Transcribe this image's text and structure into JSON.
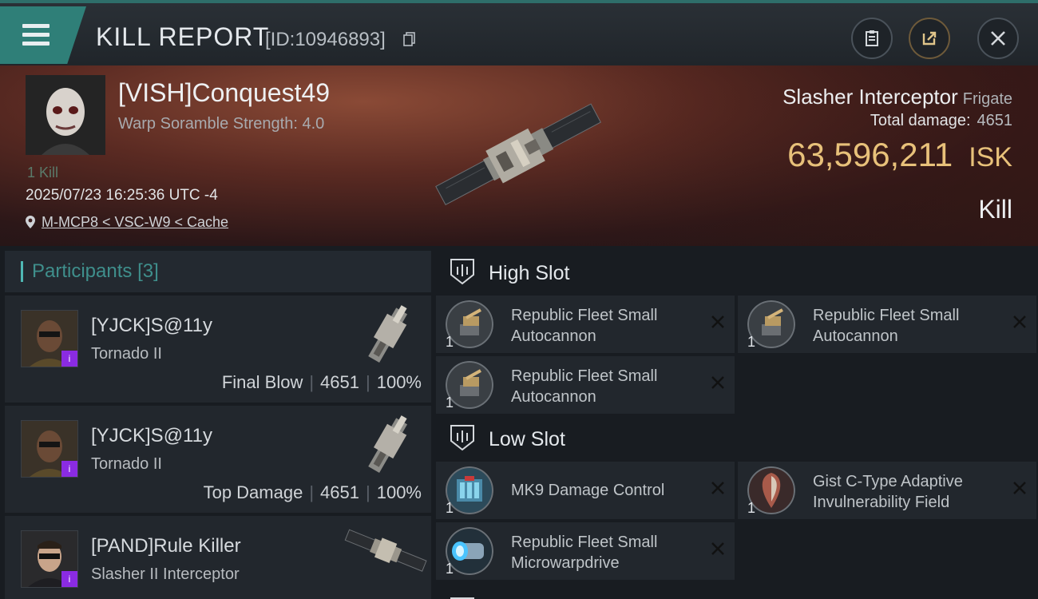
{
  "header": {
    "title": "KILL REPORT",
    "report_id": "[ID:10946893]"
  },
  "victim": {
    "name": "[VISH]Conquest49",
    "warp_strength": "Warp Soramble Strength: 4.0",
    "kill_count": "1 Kill",
    "timestamp": "2025/07/23 16:25:36 UTC -4",
    "location": "M-MCP8 < VSC-W9 < Cache",
    "ship_name": "Slasher Interceptor",
    "ship_class": "Frigate",
    "total_damage_label": "Total damage:",
    "total_damage": "4651",
    "isk_value": "63,596,211",
    "isk_unit": "ISK",
    "result": "Kill"
  },
  "participants": {
    "title": "Participants",
    "count": "[3]",
    "rows": [
      {
        "name": "[YJCK]S@11y",
        "ship": "Tornado II",
        "role": "Final Blow",
        "damage": "4651",
        "percent": "100%"
      },
      {
        "name": "[YJCK]S@11y",
        "ship": "Tornado II",
        "role": "Top Damage",
        "damage": "4651",
        "percent": "100%"
      },
      {
        "name": "[PAND]Rule Killer",
        "ship": "Slasher II Interceptor"
      }
    ]
  },
  "fittings": {
    "high_slot": {
      "title": "High Slot",
      "modules": [
        {
          "qty": "1",
          "line1": "Republic Fleet Small",
          "line2": "Autocannon"
        },
        {
          "qty": "1",
          "line1": "Republic Fleet Small",
          "line2": "Autocannon"
        },
        {
          "qty": "1",
          "line1": "Republic Fleet Small",
          "line2": "Autocannon"
        }
      ]
    },
    "low_slot": {
      "title": "Low Slot",
      "modules": [
        {
          "qty": "1",
          "line1": "MK9 Damage Control",
          "line2": ""
        },
        {
          "qty": "1",
          "line1": "Gist C-Type Adaptive",
          "line2": "Invulnerability Field"
        },
        {
          "qty": "1",
          "line1": "Republic Fleet Small",
          "line2": "Microwarpdrive"
        }
      ]
    }
  },
  "colors": {
    "accent_teal": "#2f7f78",
    "isk_gold": "#e8c17a",
    "badge_purple": "#8a2be2"
  },
  "icons": [
    "menu-icon",
    "copy-icon",
    "clipboard-icon",
    "share-icon",
    "close-icon",
    "location-pin-icon",
    "slot-icon",
    "remove-x-icon"
  ]
}
